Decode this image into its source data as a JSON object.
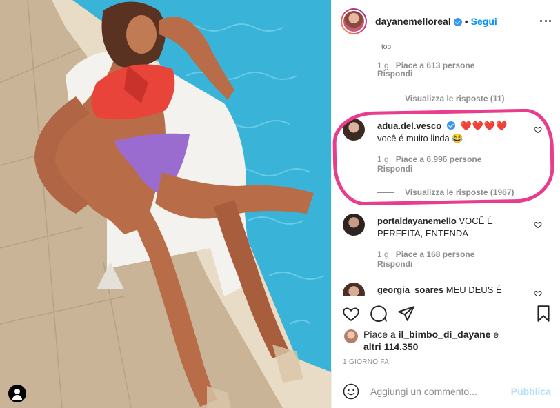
{
  "post": {
    "owner": "dayanemelloreal",
    "follow_label": "Segui",
    "separator": "•"
  },
  "comments": [
    {
      "partial_text": "top",
      "age": "1 g",
      "likes": "Piace a 613 persone",
      "reply": "Rispondi",
      "view_replies": "Visualizza le risposte (11)"
    },
    {
      "user": "adua.del.vesco",
      "verified": true,
      "hearts": "❤️❤️❤️❤️",
      "text": "você é muito linda 😂",
      "age": "1 g",
      "likes": "Piace a 6.996 persone",
      "reply": "Rispondi",
      "view_replies": "Visualizza le risposte (1967)"
    },
    {
      "user": "portaldayanemello",
      "text": "VOCÊ É PERFEITA, ENTENDA",
      "age": "1 g",
      "likes": "Piace a 168 persone",
      "reply": "Rispondi"
    },
    {
      "user": "georgia_soares",
      "text": "MEU DEUS É"
    }
  ],
  "likes_summary": {
    "prefix": "Piace a ",
    "user": "il_bimbo_di_dayane",
    "and": " e",
    "others": "altri 114.350"
  },
  "timestamp": "1 GIORNO FA",
  "composer": {
    "placeholder": "Aggiungi un commento...",
    "publish_label": "Pubblica"
  },
  "colors": {
    "accent": "#0095f6",
    "highlight": "#e83c8c",
    "heart": "#ed4956",
    "muted": "#8e8e8e"
  },
  "icons": [
    "more-icon",
    "heart-icon",
    "comment-icon",
    "share-icon",
    "bookmark-icon",
    "emoji-icon",
    "user-tag-icon",
    "verified-icon"
  ]
}
